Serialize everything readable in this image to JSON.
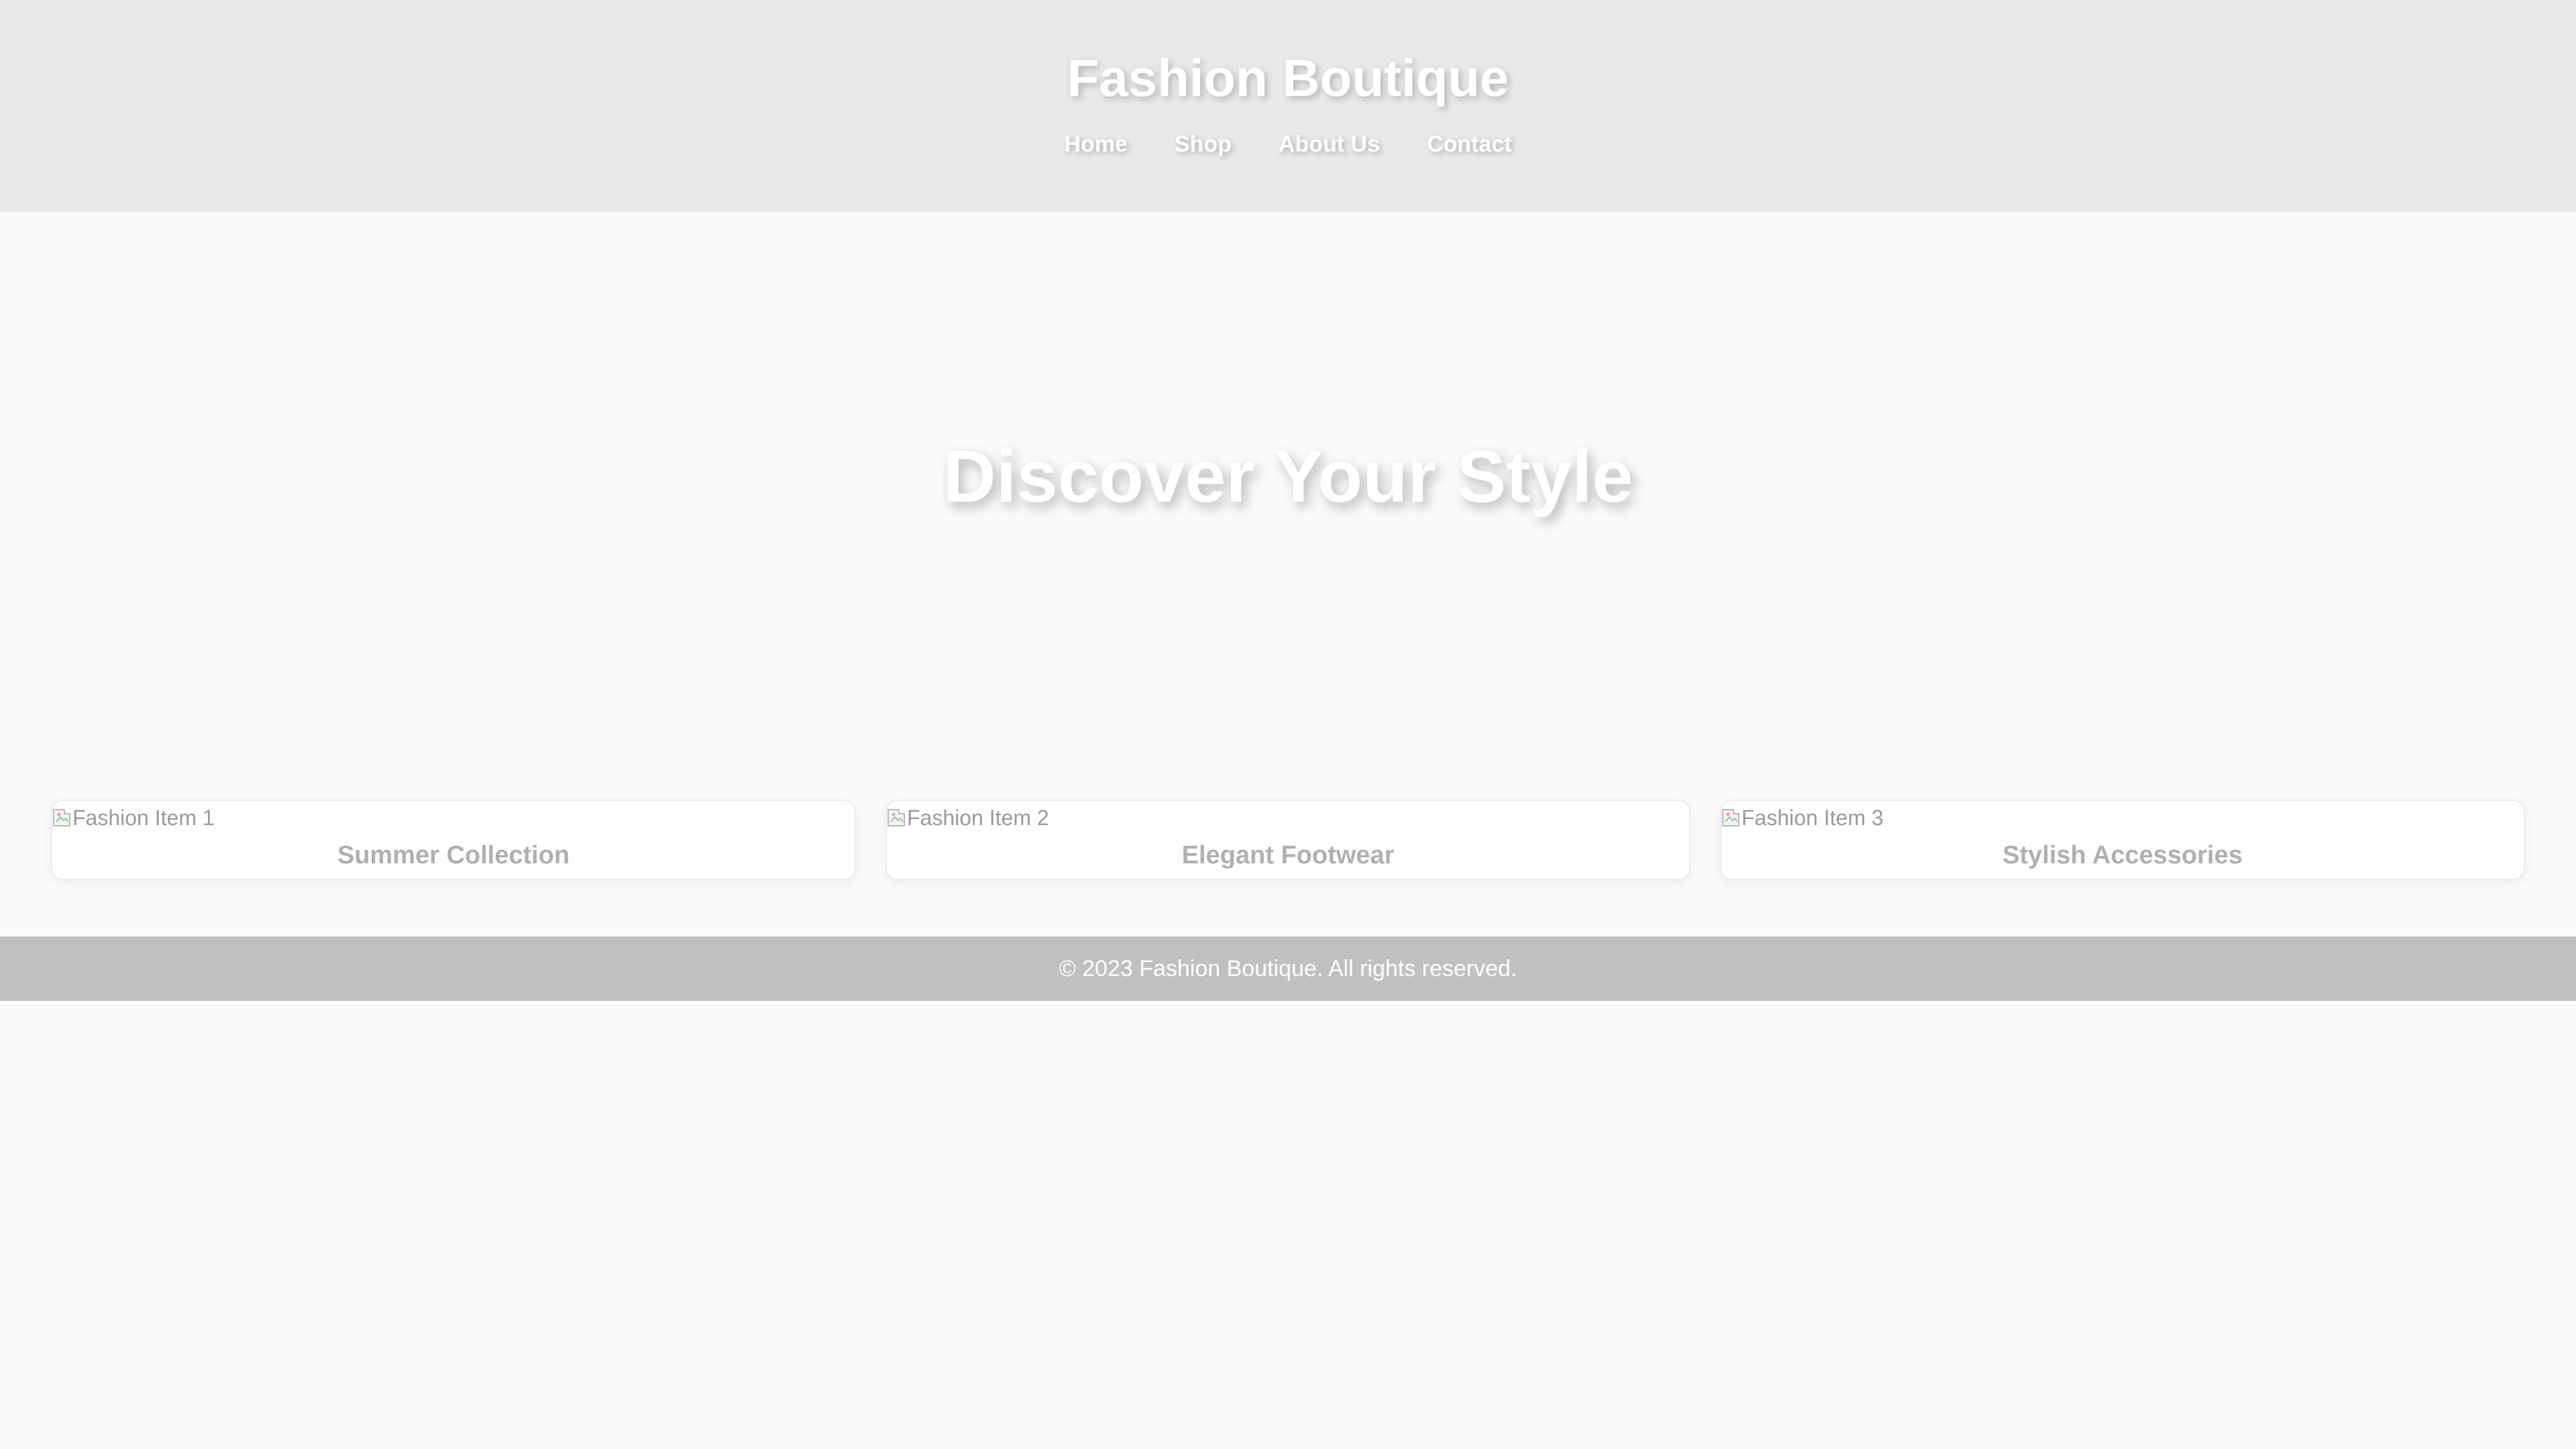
{
  "header": {
    "title": "Fashion Boutique",
    "nav": [
      {
        "label": "Home"
      },
      {
        "label": "Shop"
      },
      {
        "label": "About Us"
      },
      {
        "label": "Contact"
      }
    ]
  },
  "hero": {
    "title": "Discover Your Style"
  },
  "products": [
    {
      "image_alt": "Fashion Item 1",
      "title": "Summer Collection"
    },
    {
      "image_alt": "Fashion Item 2",
      "title": "Elegant Footwear"
    },
    {
      "image_alt": "Fashion Item 3",
      "title": "Stylish Accessories"
    }
  ],
  "footer": {
    "text": "© 2023 Fashion Boutique. All rights reserved."
  },
  "colors": {
    "header_bg": "#e8e8e8",
    "page_bg": "#fafafa",
    "footer_bg": "#c0c0c0",
    "heading_text": "#ffffff",
    "card_title": "#b0b0b0"
  }
}
